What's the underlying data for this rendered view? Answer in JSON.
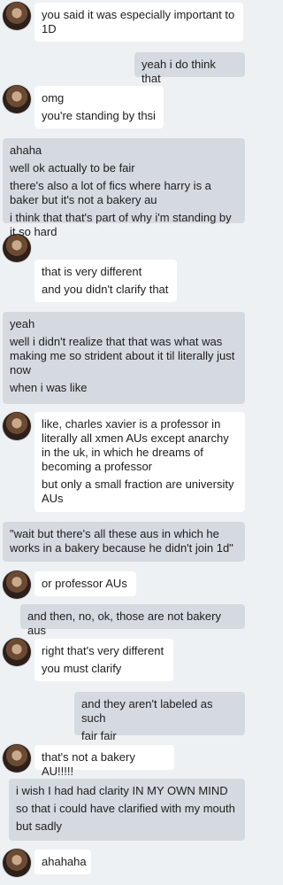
{
  "messages": [
    {
      "side": "in",
      "lines": [
        "you said it was especially important to 1D"
      ]
    },
    {
      "side": "out",
      "lines": [
        "yeah i do think that"
      ]
    },
    {
      "side": "in",
      "lines": [
        "omg",
        "you're standing by thsi"
      ]
    },
    {
      "side": "out",
      "lines": [
        "ahaha",
        "well ok actually to be fair",
        "there's also a lot of fics where harry is a baker but it's not a bakery au",
        "i think that that's part of why i'm standing by it so hard"
      ]
    },
    {
      "side": "in",
      "lines": [
        "that is very different",
        "and you didn't clarify that"
      ]
    },
    {
      "side": "out",
      "lines": [
        "yeah",
        "well i didn't realize that that was what was making me so strident about it til literally just now",
        "when i was like"
      ]
    },
    {
      "side": "in",
      "lines": [
        "like, charles xavier is a professor in literally all xmen AUs except anarchy in the uk, in which he dreams of becoming a professor",
        "but only a small fraction are university AUs"
      ]
    },
    {
      "side": "out",
      "lines": [
        "\"wait but there's all these aus in which he works in a bakery because he didn't join 1d\""
      ]
    },
    {
      "side": "in",
      "lines": [
        "or professor AUs"
      ]
    },
    {
      "side": "out",
      "lines": [
        "and then, no, ok, those are not bakery aus"
      ]
    },
    {
      "side": "in",
      "lines": [
        "right that's very different",
        "you must clarify"
      ]
    },
    {
      "side": "out",
      "lines": [
        "and they aren't labeled as such",
        "fair fair"
      ]
    },
    {
      "side": "in",
      "lines": [
        "that's not a bakery AU!!!!!"
      ]
    },
    {
      "side": "out",
      "lines": [
        "i wish I had had clarity IN MY OWN MIND",
        "so that i could have clarified with my mouth",
        "but sadly"
      ]
    },
    {
      "side": "in",
      "lines": [
        "ahahaha"
      ]
    }
  ]
}
